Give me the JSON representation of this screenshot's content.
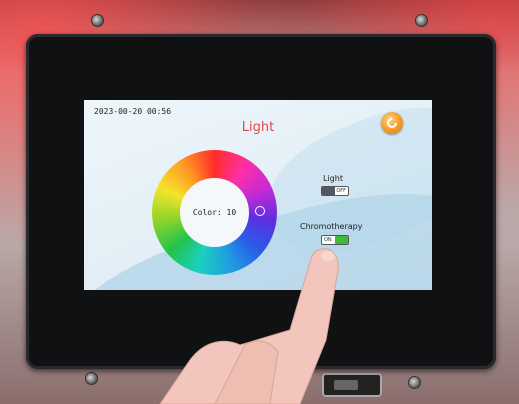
{
  "screen": {
    "datetime": "2023-00-20  00:56",
    "title": "Light",
    "return_icon": "return-arrow-icon",
    "color_wheel": {
      "label": "Color: 10",
      "marker_icon": "selector-ring-icon"
    },
    "light": {
      "label": "Light",
      "toggle_state": "OFF"
    },
    "chromotherapy": {
      "label": "Chromotherapy",
      "toggle_state": "ON"
    }
  },
  "colors": {
    "title": "#e0494d",
    "toggle_on": "#3dbb3a",
    "toggle_off": "#555566",
    "return_button": "#f39a28"
  }
}
